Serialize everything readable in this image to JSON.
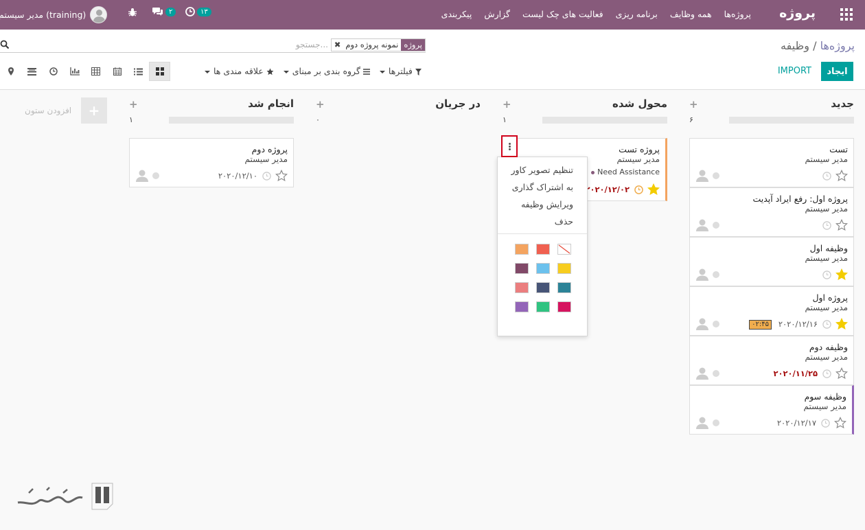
{
  "navbar": {
    "brand": "پروژه",
    "menu": [
      "پروژه‌ها",
      "همه وظایف",
      "برنامه ریزی",
      "فعالیت های چک لیست",
      "گزارش",
      "پیکربندی"
    ],
    "activity_count": "۱۳",
    "message_count": "۲",
    "user": "مدیر سیستم (training)"
  },
  "breadcrumb": {
    "parent": "پروژه‌ها",
    "separator": "/",
    "current": "وظیفه"
  },
  "search": {
    "facet_label": "پروژه",
    "facet_value": "نمونه پروژه دوم",
    "placeholder": "جستجو..."
  },
  "buttons": {
    "create": "ایجاد",
    "import": "IMPORT"
  },
  "filters": {
    "filters": "فیلترها",
    "group_by": "گروه بندی بر مبنای",
    "favorites": "علاقه مندی ها"
  },
  "columns": [
    {
      "title": "جدید",
      "count": "۶"
    },
    {
      "title": "محول شده",
      "count": "۱"
    },
    {
      "title": "در جریان",
      "count": "۰"
    },
    {
      "title": "انجام شد",
      "count": "۱"
    }
  ],
  "add_column": "افزودن ستون",
  "cards": {
    "new": [
      {
        "title": "تست",
        "user": "مدیر سیستم"
      },
      {
        "title": "پروژه اول: رفع ایراد آپدیت",
        "user": "مدیر سیستم"
      },
      {
        "title": "وظیفه اول",
        "user": "مدیر سیستم"
      },
      {
        "title": "پروژه اول",
        "user": "مدیر سیستم",
        "date": "۲۰۲۰/۱۲/۱۶",
        "timer": "۰۲:۴۵"
      },
      {
        "title": "وظیفه دوم",
        "user": "مدیر سیستم",
        "date": "۲۰۲۰/۱۱/۲۵"
      },
      {
        "title": "وظیفه سوم",
        "user": "مدیر سیستم",
        "date": "۲۰۲۰/۱۲/۱۷"
      }
    ],
    "assigned": [
      {
        "title": "پروژه تست",
        "user": "مدیر سیستم",
        "tag": "Need Assistance",
        "date": "۲۰۲۰/۱۲/۰۲"
      }
    ],
    "done": [
      {
        "title": "پروژه دوم",
        "user": "مدیر سیستم",
        "date": "۲۰۲۰/۱۲/۱۰"
      }
    ]
  },
  "card_menu": {
    "items": [
      "تنظیم تصویر کاور",
      "به اشتراک گذاری",
      "ویرایش وظیفه",
      "حذف"
    ],
    "colors": [
      "#ffffff",
      "#f06050",
      "#f4a460",
      "#f7cd1f",
      "#6cc1ed",
      "#814968",
      "#2c8397",
      "#475577",
      "#eb7e7f",
      "#d6145f",
      "#30c381",
      "#9365b8"
    ]
  },
  "colors": {
    "brand": "#875a7b",
    "accent": "#00a09d",
    "overdue": "#a50e0e",
    "highlight": "#d0021b",
    "star": "#f3cc00"
  },
  "icons": {
    "views": [
      "kanban-icon",
      "list-icon",
      "calendar-icon",
      "table-icon",
      "graph-icon",
      "activity-icon",
      "gantt-icon",
      "map-icon"
    ]
  }
}
